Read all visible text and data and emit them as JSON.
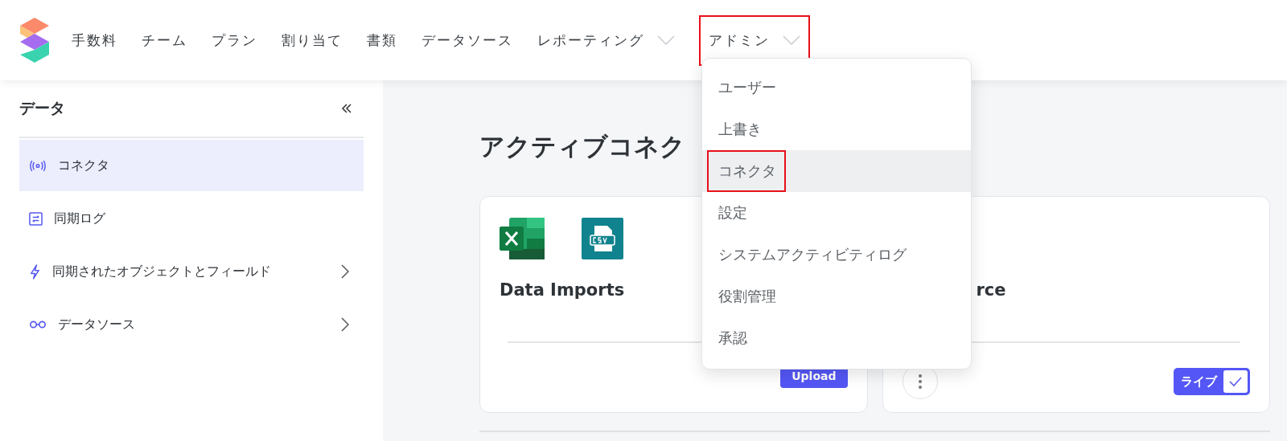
{
  "nav": {
    "items": [
      {
        "label": "手数料",
        "dropdown": false,
        "highlighted": false
      },
      {
        "label": "チーム",
        "dropdown": false,
        "highlighted": false
      },
      {
        "label": "プラン",
        "dropdown": false,
        "highlighted": false
      },
      {
        "label": "割り当て",
        "dropdown": false,
        "highlighted": false
      },
      {
        "label": "書類",
        "dropdown": false,
        "highlighted": false
      },
      {
        "label": "データソース",
        "dropdown": false,
        "highlighted": false
      },
      {
        "label": "レポーティング",
        "dropdown": true,
        "highlighted": false
      },
      {
        "label": "アドミン",
        "dropdown": true,
        "highlighted": true
      }
    ]
  },
  "admin_menu": {
    "items": [
      {
        "label": "ユーザー",
        "selected": false,
        "highlighted": false
      },
      {
        "label": "上書き",
        "selected": false,
        "highlighted": false
      },
      {
        "label": "コネクタ",
        "selected": true,
        "highlighted": true
      },
      {
        "label": "設定",
        "selected": false,
        "highlighted": false
      },
      {
        "label": "システムアクティビティログ",
        "selected": false,
        "highlighted": false
      },
      {
        "label": "役割管理",
        "selected": false,
        "highlighted": false
      },
      {
        "label": "承認",
        "selected": false,
        "highlighted": false
      }
    ]
  },
  "sidebar": {
    "title": "データ",
    "items": [
      {
        "label": "コネクタ",
        "selected": true,
        "expandable": false
      },
      {
        "label": "同期ログ",
        "selected": false,
        "expandable": false
      },
      {
        "label": "同期されたオブジェクトとフィールド",
        "selected": false,
        "expandable": true
      },
      {
        "label": "データソース",
        "selected": false,
        "expandable": true
      }
    ]
  },
  "main": {
    "heading": "アクティブコネク",
    "cards": [
      {
        "title": "Data Imports",
        "kind": "upload",
        "action": "Upload"
      },
      {
        "title": "rce",
        "kind": "live",
        "action": "ライブ",
        "checked": true
      }
    ]
  }
}
